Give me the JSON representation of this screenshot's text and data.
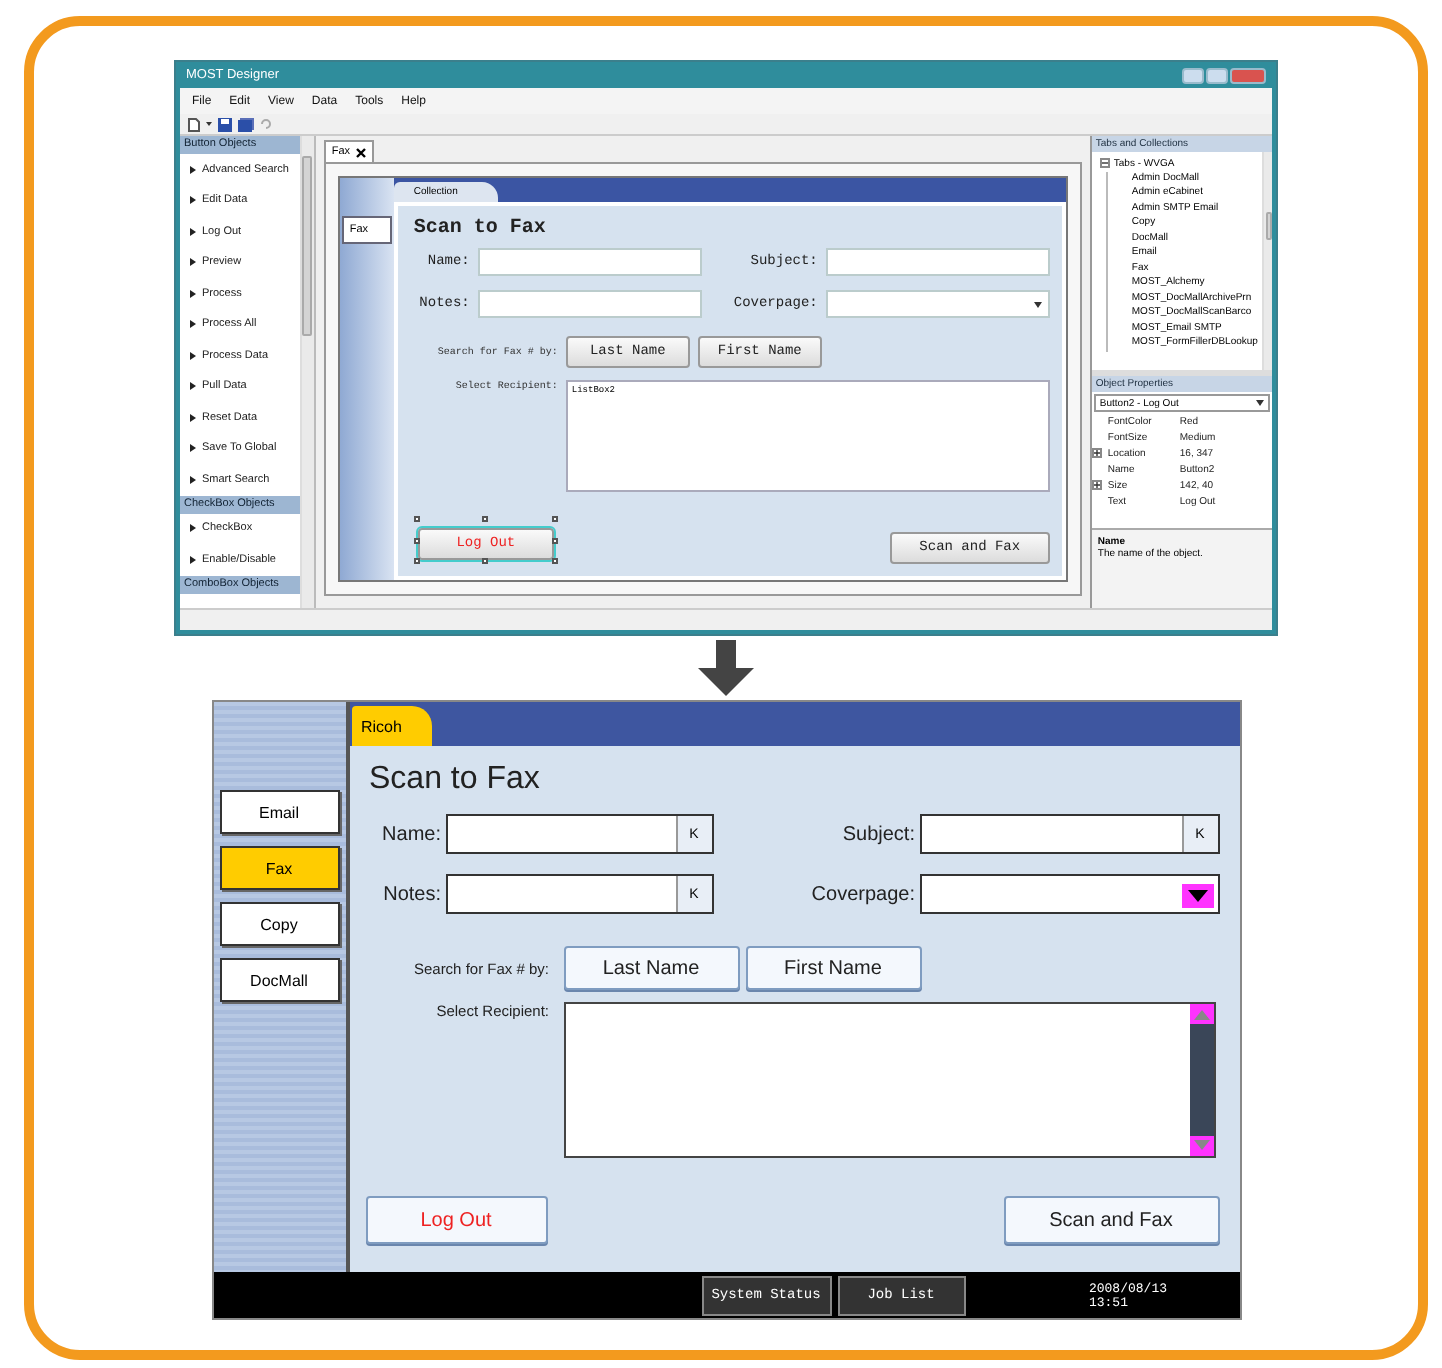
{
  "designer": {
    "title": "MOST Designer",
    "menu": [
      "File",
      "Edit",
      "View",
      "Data",
      "Tools",
      "Help"
    ],
    "toolbox": [
      {
        "header": "Button Objects",
        "items": [
          "Advanced Search",
          "Edit Data",
          "Log Out",
          "Preview",
          "Process",
          "Process All",
          "Process Data",
          "Pull Data",
          "Reset Data",
          "Save To Global",
          "Smart Search"
        ]
      },
      {
        "header": "CheckBox Objects",
        "items": [
          "CheckBox",
          "Enable/Disable"
        ]
      },
      {
        "header": "ComboBox Objects"
      }
    ],
    "document_tab": "Fax",
    "canvas": {
      "side_tabs": [
        {
          "label": "Fax",
          "selected": true
        }
      ],
      "collection_tab": "Collection",
      "title": "Scan to Fax",
      "fields": [
        {
          "label": "Name:",
          "kind": "text"
        },
        {
          "label": "Subject:",
          "kind": "text"
        },
        {
          "label": "Notes:",
          "kind": "text"
        },
        {
          "label": "Coverpage:",
          "kind": "dropdown"
        }
      ],
      "search_label": "Search for Fax # by:",
      "search_buttons": [
        "Last Name",
        "First Name"
      ],
      "recipient_label": "Select Recipient:",
      "listbox_value": "ListBox2",
      "buttons": [
        {
          "label": "Log Out",
          "kind": "danger",
          "selected": true
        },
        {
          "label": "Scan and Fax",
          "kind": "normal",
          "selected": false
        }
      ]
    },
    "tabs_panel": {
      "header": "Tabs and Collections",
      "root": {
        "label": "Tabs - WVGA",
        "expanded": true,
        "children": [
          "Admin DocMall",
          "Admin eCabinet",
          "Admin SMTP Email",
          "Copy",
          "DocMall",
          "Email",
          "Fax",
          "MOST_Alchemy",
          "MOST_DocMallArchivePrn",
          "MOST_DocMallScanBarco",
          "MOST_Email SMTP",
          "MOST_FormFillerDBLookup"
        ]
      }
    },
    "properties": {
      "header": "Object Properties",
      "object": "Button2 - Log Out",
      "rows": [
        {
          "name": "FontColor",
          "value": "Red",
          "kind": "plain"
        },
        {
          "name": "FontSize",
          "value": "Medium",
          "kind": "plain"
        },
        {
          "name": "Location",
          "value": "16, 347",
          "kind": "group"
        },
        {
          "name": "Name",
          "value": "Button2",
          "kind": "plain"
        },
        {
          "name": "Size",
          "value": "142, 40",
          "kind": "group"
        },
        {
          "name": "Text",
          "value": "Log Out",
          "kind": "plain"
        }
      ],
      "description_title": "Name",
      "description": "The name of the object."
    }
  },
  "device": {
    "side_tabs": [
      {
        "label": "Email",
        "selected": false
      },
      {
        "label": "Fax",
        "selected": true
      },
      {
        "label": "Copy",
        "selected": false
      },
      {
        "label": "DocMall",
        "selected": false
      }
    ],
    "top_tab": "Ricoh",
    "title": "Scan to Fax",
    "fields": [
      {
        "label": "Name:",
        "kind": "text",
        "key": "K"
      },
      {
        "label": "Subject:",
        "kind": "text",
        "key": "K"
      },
      {
        "label": "Notes:",
        "kind": "text",
        "key": "K"
      },
      {
        "label": "Coverpage:",
        "kind": "dropdown"
      }
    ],
    "search_label": "Search for Fax # by:",
    "search_buttons": [
      "Last Name",
      "First Name"
    ],
    "recipient_label": "Select Recipient:",
    "buttons": [
      {
        "label": "Log Out",
        "kind": "danger"
      },
      {
        "label": "Scan and Fax",
        "kind": "normal"
      }
    ],
    "footer_buttons": [
      "System Status",
      "Job List"
    ],
    "date": "2008/08/13",
    "time": "13:51"
  }
}
